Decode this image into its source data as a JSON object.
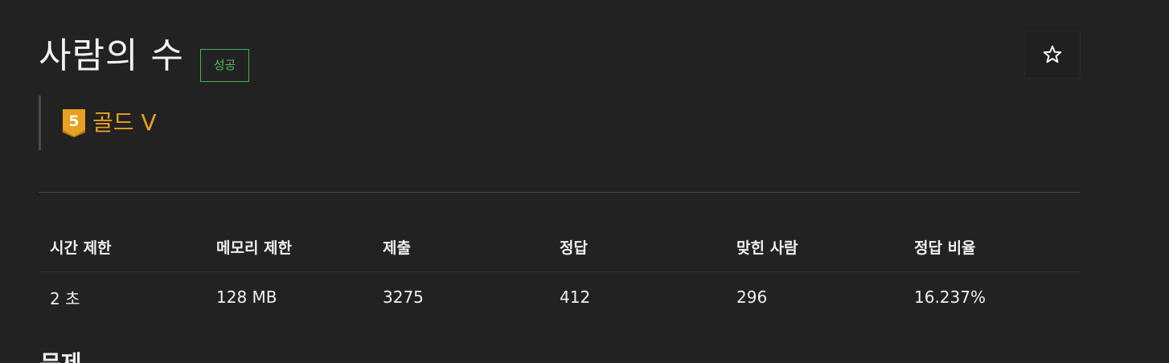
{
  "problem": {
    "title": "사람의 수",
    "status_badge": "성공",
    "tier": {
      "level": "5",
      "label": "골드 V",
      "color": "#e8a020"
    },
    "favorite_icon": "star-icon"
  },
  "stats": {
    "headers": [
      "시간 제한",
      "메모리 제한",
      "제출",
      "정답",
      "맞힌 사람",
      "정답 비율"
    ],
    "values": [
      "2 초",
      "128 MB",
      "3275",
      "412",
      "296",
      "16.237%"
    ]
  },
  "next_section_peek": "문제"
}
